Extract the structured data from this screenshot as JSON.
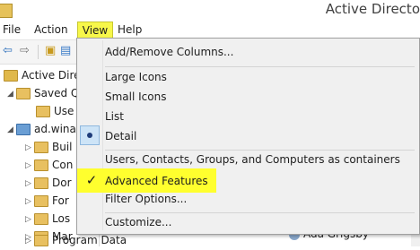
{
  "window": {
    "title": "Active Directo"
  },
  "menubar": {
    "items": [
      "File",
      "Action",
      "View",
      "Help"
    ]
  },
  "tree": {
    "items": [
      {
        "label": "Active Direc",
        "indent": 0,
        "expander": ""
      },
      {
        "label": "Saved Q",
        "indent": 1,
        "expander": "◢"
      },
      {
        "label": "Use",
        "indent": 2,
        "expander": ""
      },
      {
        "label": "ad.wina",
        "indent": 1,
        "expander": "◢"
      },
      {
        "label": "Buil",
        "indent": 2,
        "expander": "▷"
      },
      {
        "label": "Con",
        "indent": 2,
        "expander": "▷"
      },
      {
        "label": "Dor",
        "indent": 2,
        "expander": "▷"
      },
      {
        "label": "For",
        "indent": 2,
        "expander": "▷"
      },
      {
        "label": "Los",
        "indent": 2,
        "expander": "▷"
      },
      {
        "label": "Mar",
        "indent": 2,
        "expander": "▷"
      },
      {
        "label": "Program Data",
        "indent": 2,
        "expander": "▷"
      }
    ]
  },
  "right_pane": {
    "visible_row": "Ada Grigsby"
  },
  "view_menu": {
    "items": {
      "add_remove_columns": "Add/Remove Columns...",
      "large_icons": "Large Icons",
      "small_icons": "Small Icons",
      "list": "List",
      "detail": "Detail",
      "users_as_containers": "Users, Contacts, Groups, and Computers as containers",
      "advanced_features": "Advanced Features",
      "filter_options": "Filter Options...",
      "customize": "Customize..."
    },
    "checked_item": "advanced_features",
    "selected_view": "detail"
  },
  "colors": {
    "highlight": "#ffff2e",
    "radio_fill": "#cde4f7",
    "radio_dot": "#1f3d7a"
  }
}
